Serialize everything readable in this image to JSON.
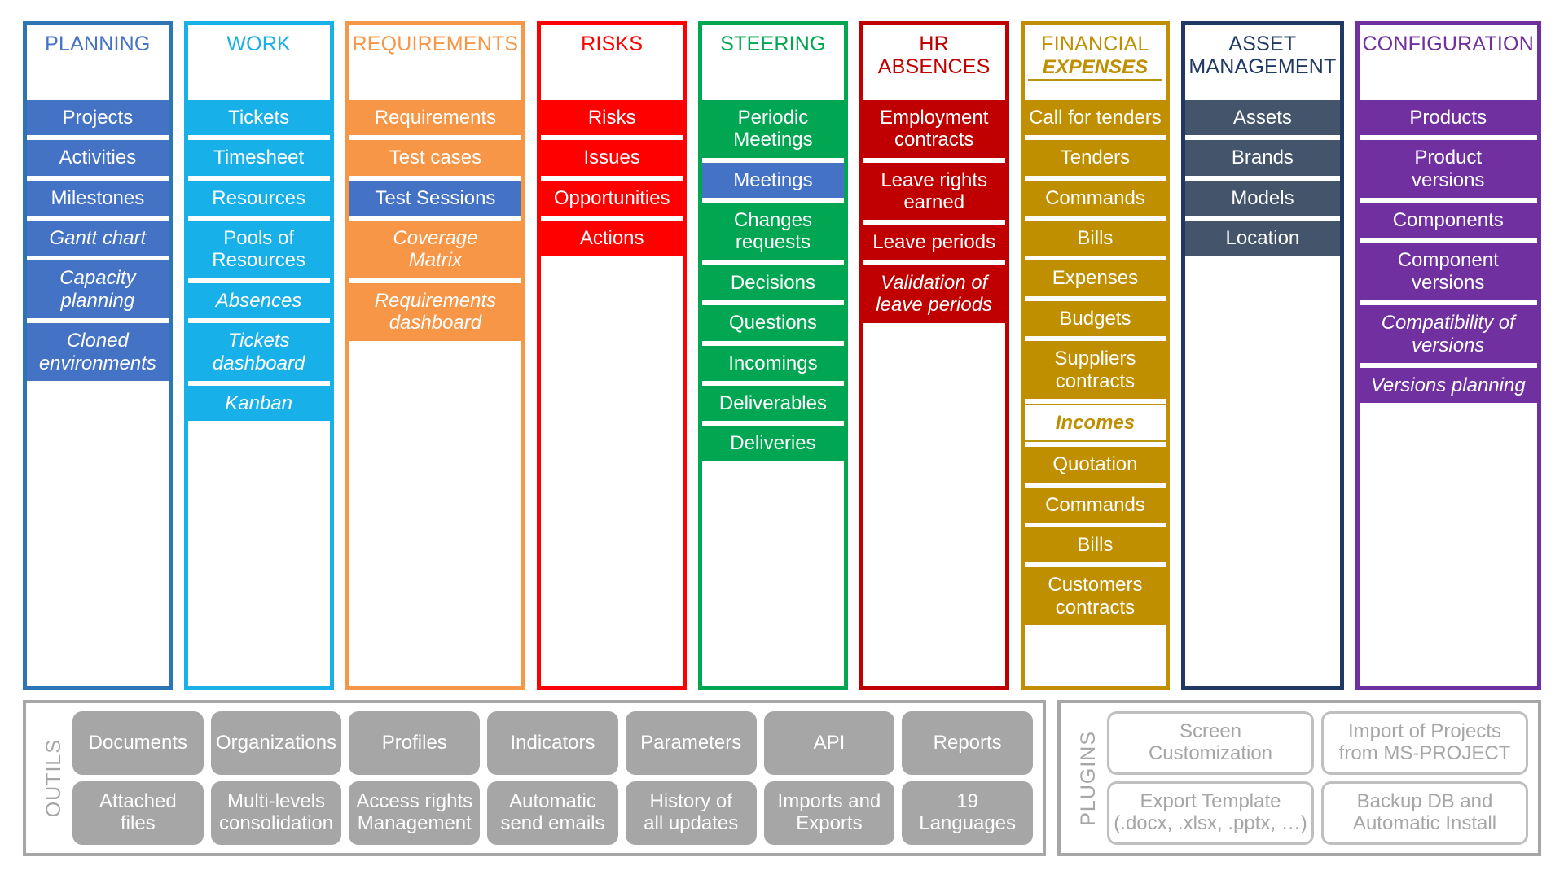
{
  "columns": [
    {
      "id": "planning",
      "title": "PLANNING",
      "title_color": "#4472c4",
      "border_color": "#2e75b6",
      "item_color": "#4472c4",
      "items": [
        {
          "label": "Projects",
          "italic": false,
          "highlight": false
        },
        {
          "label": "Activities",
          "italic": false,
          "highlight": false
        },
        {
          "label": "Milestones",
          "italic": false,
          "highlight": false
        },
        {
          "label": "Gantt chart",
          "italic": true,
          "highlight": false
        },
        {
          "label": "Capacity\nplanning",
          "italic": true,
          "highlight": false
        },
        {
          "label": "Cloned\nenvironments",
          "italic": true,
          "highlight": false
        }
      ]
    },
    {
      "id": "work",
      "title": "WORK",
      "title_color": "#18b0e8",
      "border_color": "#18b0e8",
      "item_color": "#18b0e8",
      "items": [
        {
          "label": "Tickets",
          "italic": false,
          "highlight": false
        },
        {
          "label": "Timesheet",
          "italic": false,
          "highlight": false
        },
        {
          "label": "Resources",
          "italic": false,
          "highlight": false
        },
        {
          "label": "Pools of\nResources",
          "italic": false,
          "highlight": false
        },
        {
          "label": "Absences",
          "italic": true,
          "highlight": false
        },
        {
          "label": "Tickets\ndashboard",
          "italic": true,
          "highlight": false
        },
        {
          "label": "Kanban",
          "italic": true,
          "highlight": false
        }
      ]
    },
    {
      "id": "requirements",
      "title": "REQUIREMENTS",
      "title_color": "#f79646",
      "border_color": "#f79646",
      "item_color": "#f79646",
      "items": [
        {
          "label": "Requirements",
          "italic": false,
          "highlight": false
        },
        {
          "label": "Test cases",
          "italic": false,
          "highlight": false
        },
        {
          "label": "Test Sessions",
          "italic": false,
          "highlight": true
        },
        {
          "label": "Coverage\nMatrix",
          "italic": true,
          "highlight": false
        },
        {
          "label": "Requirements\ndashboard",
          "italic": true,
          "highlight": false
        }
      ]
    },
    {
      "id": "risks",
      "title": "RISKS",
      "title_color": "#ff0000",
      "border_color": "#ff0000",
      "item_color": "#ff0000",
      "items": [
        {
          "label": "Risks",
          "italic": false,
          "highlight": false
        },
        {
          "label": "Issues",
          "italic": false,
          "highlight": false
        },
        {
          "label": "Opportunities",
          "italic": false,
          "highlight": false
        },
        {
          "label": "Actions",
          "italic": false,
          "highlight": false
        }
      ]
    },
    {
      "id": "steering",
      "title": "STEERING",
      "title_color": "#00a651",
      "border_color": "#00a651",
      "item_color": "#00a651",
      "items": [
        {
          "label": "Periodic\nMeetings",
          "italic": false,
          "highlight": false
        },
        {
          "label": "Meetings",
          "italic": false,
          "highlight": true
        },
        {
          "label": "Changes\nrequests",
          "italic": false,
          "highlight": false
        },
        {
          "label": "Decisions",
          "italic": false,
          "highlight": false
        },
        {
          "label": "Questions",
          "italic": false,
          "highlight": false
        },
        {
          "label": "Incomings",
          "italic": false,
          "highlight": false
        },
        {
          "label": "Deliverables",
          "italic": false,
          "highlight": false
        },
        {
          "label": "Deliveries",
          "italic": false,
          "highlight": false
        }
      ]
    },
    {
      "id": "hr-absences",
      "title": "HR  ABSENCES",
      "title_color": "#c00000",
      "border_color": "#c00000",
      "item_color": "#c00000",
      "items": [
        {
          "label": "Employment\ncontracts",
          "italic": false,
          "highlight": false
        },
        {
          "label": "Leave rights\nearned",
          "italic": false,
          "highlight": false
        },
        {
          "label": "Leave periods",
          "italic": false,
          "highlight": false
        },
        {
          "label": "Validation of\nleave periods",
          "italic": true,
          "highlight": false
        }
      ]
    },
    {
      "id": "financial",
      "title": "FINANCIAL",
      "subtitle": "EXPENSES",
      "title_color": "#bf8f00",
      "border_color": "#bf8f00",
      "item_color": "#bf8f00",
      "items": [
        {
          "label": "Call for tenders",
          "italic": false,
          "highlight": false
        },
        {
          "label": "Tenders",
          "italic": false,
          "highlight": false
        },
        {
          "label": "Commands",
          "italic": false,
          "highlight": false
        },
        {
          "label": "Bills",
          "italic": false,
          "highlight": false
        },
        {
          "label": "Expenses",
          "italic": false,
          "highlight": false
        },
        {
          "label": "Budgets",
          "italic": false,
          "highlight": false
        },
        {
          "label": "Suppliers\ncontracts",
          "italic": false,
          "highlight": false
        },
        {
          "label": "Incomes",
          "italic": true,
          "highlight": false,
          "white_sub": true
        },
        {
          "label": "Quotation",
          "italic": false,
          "highlight": false
        },
        {
          "label": "Commands",
          "italic": false,
          "highlight": false
        },
        {
          "label": "Bills",
          "italic": false,
          "highlight": false
        },
        {
          "label": "Customers\ncontracts",
          "italic": false,
          "highlight": false
        }
      ]
    },
    {
      "id": "asset-management",
      "title": "ASSET\nMANAGEMENT",
      "title_color": "#1f3864",
      "border_color": "#1f3864",
      "item_color": "#44546a",
      "items": [
        {
          "label": "Assets",
          "italic": false,
          "highlight": false
        },
        {
          "label": "Brands",
          "italic": false,
          "highlight": false
        },
        {
          "label": "Models",
          "italic": false,
          "highlight": false
        },
        {
          "label": "Location",
          "italic": false,
          "highlight": false
        }
      ]
    },
    {
      "id": "configuration",
      "title": "CONFIGURATION",
      "title_color": "#7030a0",
      "border_color": "#7030a0",
      "item_color": "#7030a0",
      "items": [
        {
          "label": "Products",
          "italic": false,
          "highlight": false
        },
        {
          "label": "Product\nversions",
          "italic": false,
          "highlight": false
        },
        {
          "label": "Components",
          "italic": false,
          "highlight": false
        },
        {
          "label": "Component\nversions",
          "italic": false,
          "highlight": false
        },
        {
          "label": "Compatibility of\nversions",
          "italic": true,
          "highlight": false
        },
        {
          "label": "Versions planning",
          "italic": true,
          "highlight": false
        }
      ]
    }
  ],
  "outils": {
    "label": "OUTILS",
    "buttons": [
      "Documents",
      "Organizations",
      "Profiles",
      "Indicators",
      "Parameters",
      "API",
      "Reports",
      "Attached\nfiles",
      "Multi-levels\nconsolidation",
      "Access rights\nManagement",
      "Automatic\nsend emails",
      "History of\nall updates",
      "Imports and\nExports",
      "19\nLanguages"
    ]
  },
  "plugins": {
    "label": "PLUGINS",
    "buttons": [
      "Screen\nCustomization",
      "Import of Projects\nfrom MS-PROJECT",
      "Export Template\n(.docx, .xlsx, .pptx, …)",
      "Backup DB and\nAutomatic Install"
    ]
  },
  "colors": {
    "highlight": "#4472c4",
    "panel_border": "#a6a6a6",
    "button_fill": "#a6a6a6",
    "button_outline": "#bfbfbf"
  }
}
